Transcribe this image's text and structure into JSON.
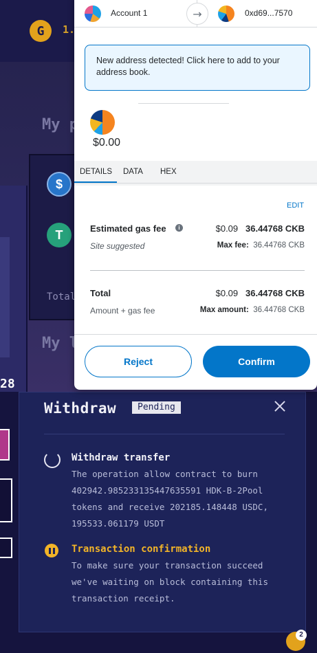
{
  "dapp": {
    "logo_glyph": "G",
    "balance": "1.",
    "heading_portfolio": "My p",
    "heading_liquidity": "My l",
    "coin_usdc": "$",
    "coin_usdt": "T",
    "total_label": "Total",
    "side_value": "28"
  },
  "metamask": {
    "from_account": "Account 1",
    "to_address": "0xd69...7570",
    "notice": "New address detected! Click here to add to your address book.",
    "amount": "$0.00",
    "tabs": [
      "DETAILS",
      "DATA",
      "HEX"
    ],
    "edit_label": "EDIT",
    "gas": {
      "label": "Estimated gas fee",
      "fiat": "$0.09",
      "amount": "36.44768 CKB",
      "sub_label": "Site suggested",
      "max_label": "Max fee:",
      "max_value": "36.44768 CKB"
    },
    "total": {
      "label": "Total",
      "fiat": "$0.09",
      "amount": "36.44768 CKB",
      "sub_label": "Amount + gas fee",
      "max_label": "Max amount:",
      "max_value": "36.44768 CKB"
    },
    "reject_label": "Reject",
    "confirm_label": "Confirm",
    "accent_color": "#0376c9"
  },
  "withdraw": {
    "title": "Withdraw",
    "status": "Pending",
    "steps": [
      {
        "title": "Withdraw transfer",
        "text": "The operation allow contract to burn\n402942.985233135447635591 HDK-B-2Pool\ntokens and receive 202185.148448 USDC,\n195533.061179 USDT",
        "state": "in-progress"
      },
      {
        "title": "Transaction confirmation",
        "text": "To make sure your transaction succeed\nwe've waiting on block containing this\ntransaction receipt.",
        "state": "paused"
      }
    ],
    "step_active_color": "#f2b428"
  },
  "notifications": {
    "count": "2"
  }
}
